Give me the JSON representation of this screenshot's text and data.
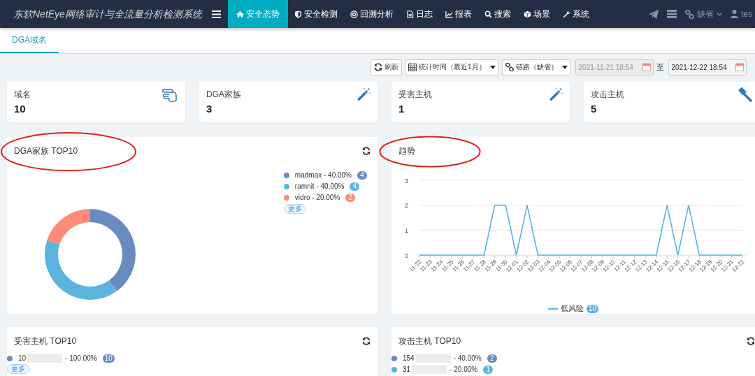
{
  "navbar": {
    "brand": "东软NetEye网络审计与全流量分析检测系统",
    "menu": [
      {
        "label": "安全态势",
        "selected": true
      },
      {
        "label": "安全检测",
        "selected": false
      },
      {
        "label": "回溯分析",
        "selected": false
      },
      {
        "label": "日志",
        "selected": false
      },
      {
        "label": "报表",
        "selected": false
      },
      {
        "label": "搜索",
        "selected": false
      },
      {
        "label": "场景",
        "selected": false
      },
      {
        "label": "系统",
        "selected": false
      }
    ],
    "link_selector": "缺省",
    "user": "tes"
  },
  "tabs": [
    {
      "label": "DGA域名",
      "selected": true
    }
  ],
  "toolbar": {
    "refresh": "刷新",
    "time_range": "统计时间（最近1月）",
    "link": "链路（缺省）",
    "date_from": {
      "value": "2021-11-21 18:54",
      "disabled": true
    },
    "separator": "至",
    "date_to": {
      "value": "2021-12-22 18:54",
      "disabled": false
    }
  },
  "stats": [
    {
      "label": "域名",
      "value": "10"
    },
    {
      "label": "DGA家族",
      "value": "3"
    },
    {
      "label": "受害主机",
      "value": "1"
    },
    {
      "label": "攻击主机",
      "value": "5"
    }
  ],
  "panels": [
    {
      "title": "DGA家族 TOP10",
      "kind": "chart",
      "circled": true,
      "more": "更多",
      "legend": [
        {
          "percent": "- 40.00%",
          "count": "4",
          "color": "#6a8bc0"
        },
        {
          "percent": "- 40.00%",
          "count": "4",
          "color": "#5ab4de"
        },
        {
          "percent": "- 20.00%",
          "count": "2",
          "color": "#fc8a78"
        }
      ],
      "chart_data": {
        "type": "donut",
        "categories": [
          "madmax",
          "ramnit",
          "vidro"
        ],
        "values": [
          40,
          40,
          20
        ]
      }
    },
    {
      "title": "趋势",
      "kind": "chart",
      "circled": true,
      "legend_count": "10",
      "chart_data": {
        "type": "line",
        "categories": [
          "11-22",
          "11-23",
          "11-24",
          "11-25",
          "11-26",
          "11-27",
          "11-28",
          "11-29",
          "11-30",
          "12-01",
          "12-02",
          "12-03",
          "12-04",
          "12-05",
          "12-06",
          "12-07",
          "12-08",
          "12-09",
          "12-10",
          "12-11",
          "12-12",
          "12-13",
          "12-14",
          "12-15",
          "12-16",
          "12-17",
          "12-18",
          "12-19",
          "12-20",
          "12-21",
          "12-22"
        ],
        "series": [
          {
            "name": "低风险",
            "color": "#5ab4de",
            "values": [
              0,
              0,
              0,
              0,
              0,
              0,
              0,
              2,
              2,
              0,
              2,
              0,
              0,
              0,
              0,
              0,
              0,
              0,
              0,
              0,
              0,
              0,
              0,
              2,
              0,
              2,
              0,
              0,
              0,
              0,
              0
            ]
          }
        ],
        "ylim": [
          0,
          3
        ],
        "yticks": [
          0,
          1,
          2,
          3
        ]
      }
    },
    {
      "title": "受害主机 TOP10",
      "kind": "list",
      "circled": false,
      "more": "更多",
      "legend": [
        {
          "label": "10",
          "redacted": true,
          "suffix": "- 100.00%",
          "count": "10",
          "color": "#6a8bc0"
        }
      ]
    },
    {
      "title": "攻击主机 TOP10",
      "kind": "list",
      "circled": false,
      "legend": [
        {
          "label": "154",
          "redacted": true,
          "suffix": "- 40.00%",
          "count": "2",
          "color": "#6a8bc0"
        },
        {
          "label": "31",
          "redacted": true,
          "suffix": "- 20.00%",
          "count": "1",
          "color": "#5ab4de"
        }
      ]
    }
  ]
}
